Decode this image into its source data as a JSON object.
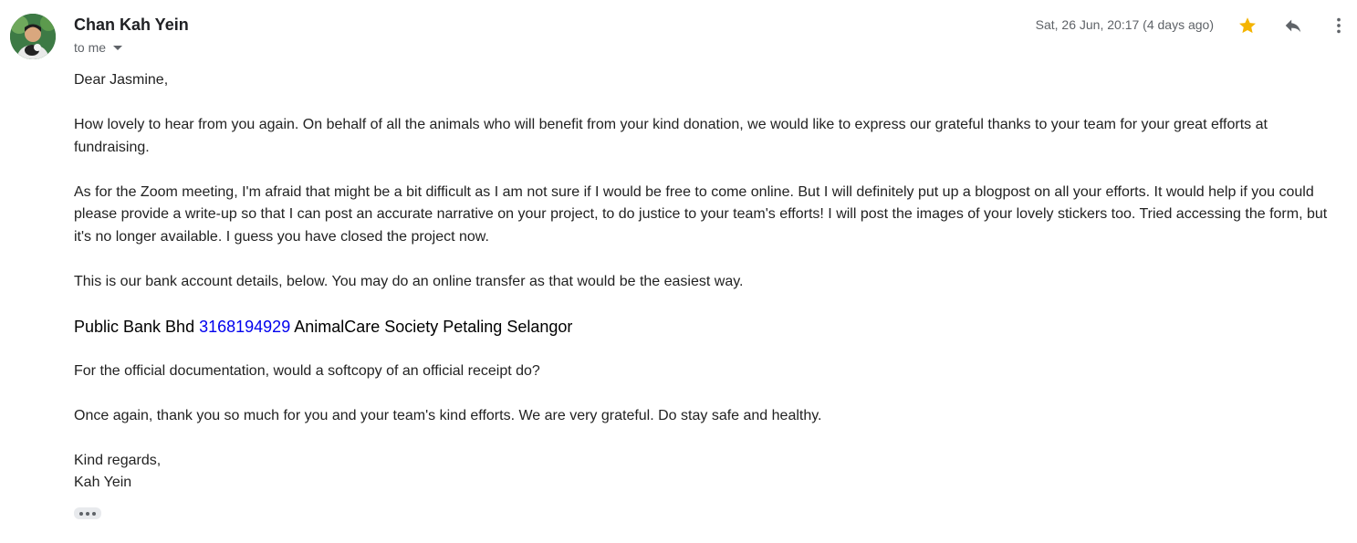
{
  "sender": {
    "name": "Chan Kah Yein",
    "recipient_label": "to me",
    "timestamp": "Sat, 26 Jun, 20:17 (4 days ago)",
    "avatar_icon": "person-avatar-photo",
    "starred": true
  },
  "actions": {
    "star_icon": "star-icon",
    "reply_icon": "reply-icon",
    "more_icon": "more-vert-icon"
  },
  "message": {
    "greeting": "Dear Jasmine,",
    "paragraph_1": "How lovely to hear from you again.  On behalf of all the animals who will benefit from your kind donation, we would like to express our grateful thanks to your team for your great efforts at fundraising.",
    "paragraph_2": "As for the Zoom meeting, I'm afraid that might be a bit difficult as I am not sure if I would be free to come online. But I will definitely put up a blogpost on all your efforts.  It would help if you could please provide a write-up so that I can post an accurate narrative on your project, to do justice to your team's efforts!  I will post the images of your lovely stickers too.  Tried accessing the form, but it's no longer available.  I guess you have closed the project now.",
    "paragraph_3": "This is our bank account details, below.  You may do an online transfer as that would be the easiest way.",
    "bank": {
      "bank_name": "Public Bank Bhd ",
      "account_number": "3168194929",
      "account_name": " AnimalCare Society Petaling Selangor"
    },
    "paragraph_4": "For the official documentation, would a softcopy of an official receipt do?",
    "paragraph_5": "Once again, thank you so much for you and your team's kind efforts.  We are very grateful. Do stay safe and healthy.",
    "signoff": "Kind regards,",
    "signature": "Kah Yein"
  },
  "colors": {
    "star": "#f4b400",
    "link": "#0000ee",
    "muted_text": "#5f6368"
  }
}
